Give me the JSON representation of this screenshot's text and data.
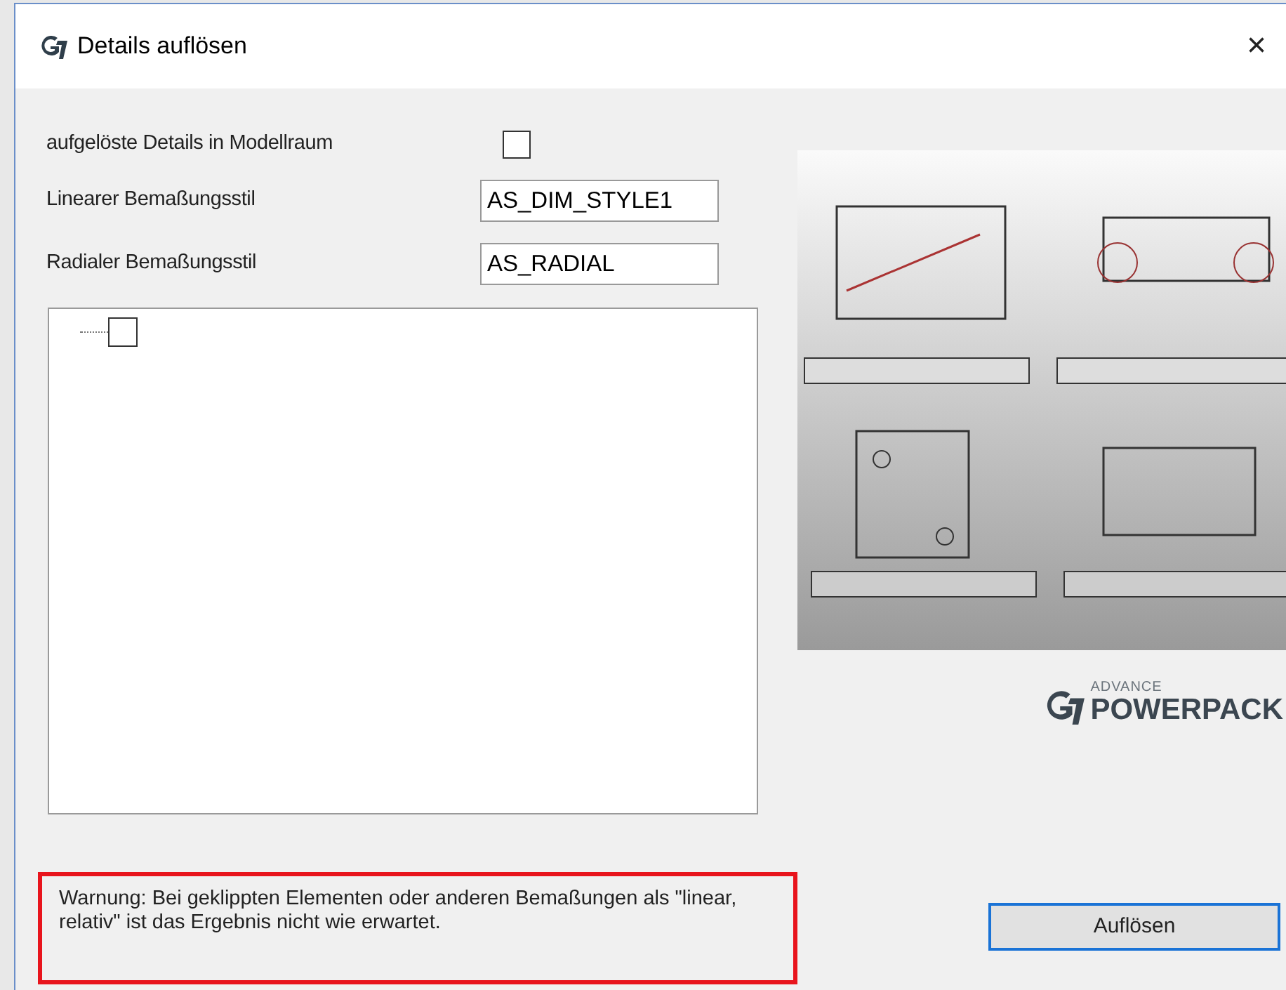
{
  "window": {
    "title": "Details auflösen",
    "close": "×"
  },
  "options": {
    "model_space_label": "aufgelöste Details in Modellraum",
    "model_space_checked": false,
    "linear_label": "Linearer Bemaßungsstil",
    "linear_value": "AS_DIM_STYLE1",
    "radial_label": "Radialer Bemaßungsstil",
    "radial_value": "AS_RADIAL"
  },
  "tree": {
    "items": [
      {
        "checked": false
      }
    ]
  },
  "logo": {
    "small": "ADVANCE",
    "large": "POWERPACK"
  },
  "warning": "Warnung: Bei geklippten Elementen oder anderen Bemaßungen als \"linear, relativ\" ist das Ergebnis nicht wie erwartet.",
  "buttons": [
    {
      "label": "Auflösen"
    }
  ]
}
